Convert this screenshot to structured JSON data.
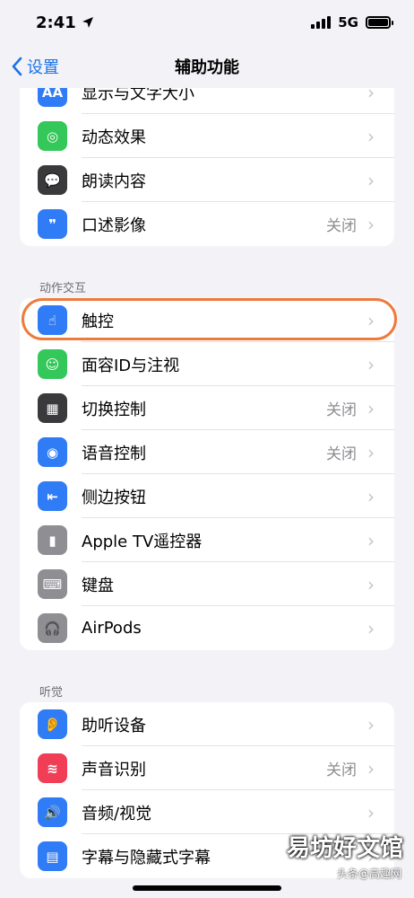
{
  "status": {
    "time": "2:41",
    "network": "5G"
  },
  "nav": {
    "back_label": "设置",
    "title": "辅助功能"
  },
  "sections": {
    "motion": "动作交互",
    "hearing": "听觉"
  },
  "vision_items": [
    {
      "label": "显示与文字大小",
      "value": "",
      "icon": "text-size-icon",
      "glyph": "AA",
      "color": "#2f7cf6"
    },
    {
      "label": "动态效果",
      "value": "",
      "icon": "motion-icon",
      "glyph": "◎",
      "color": "#34c759"
    },
    {
      "label": "朗读内容",
      "value": "",
      "icon": "speech-bubble-icon",
      "glyph": "💬",
      "color": "#3a3a3c"
    },
    {
      "label": "口述影像",
      "value": "关闭",
      "icon": "audio-description-icon",
      "glyph": "❞",
      "color": "#2f7cf6"
    }
  ],
  "motion_items": [
    {
      "label": "触控",
      "value": "",
      "icon": "touch-hand-icon",
      "glyph": "☝",
      "color": "#2f7cf6"
    },
    {
      "label": "面容ID与注视",
      "value": "",
      "icon": "face-id-icon",
      "glyph": "☺",
      "color": "#34c759"
    },
    {
      "label": "切换控制",
      "value": "关闭",
      "icon": "switch-control-icon",
      "glyph": "▦",
      "color": "#3a3a3c"
    },
    {
      "label": "语音控制",
      "value": "关闭",
      "icon": "voice-control-icon",
      "glyph": "◉",
      "color": "#2f7cf6"
    },
    {
      "label": "侧边按钮",
      "value": "",
      "icon": "side-button-icon",
      "glyph": "⇤",
      "color": "#2f7cf6"
    },
    {
      "label": "Apple TV遥控器",
      "value": "",
      "icon": "remote-icon",
      "glyph": "▮",
      "color": "#8e8e93"
    },
    {
      "label": "键盘",
      "value": "",
      "icon": "keyboard-icon",
      "glyph": "⌨",
      "color": "#8e8e93"
    },
    {
      "label": "AirPods",
      "value": "",
      "icon": "headphones-icon",
      "glyph": "🎧",
      "color": "#8e8e93"
    }
  ],
  "hearing_items": [
    {
      "label": "助听设备",
      "value": "",
      "icon": "ear-icon",
      "glyph": "👂",
      "color": "#2f7cf6"
    },
    {
      "label": "声音识别",
      "value": "关闭",
      "icon": "sound-recognition-icon",
      "glyph": "≋",
      "color": "#ef3e55"
    },
    {
      "label": "音频/视觉",
      "value": "",
      "icon": "speaker-eye-icon",
      "glyph": "🔊",
      "color": "#2f7cf6"
    },
    {
      "label": "字幕与隐藏式字幕",
      "value": "",
      "icon": "captions-icon",
      "glyph": "▤",
      "color": "#2f7cf6"
    }
  ],
  "watermark": {
    "main": "易坊好文馆",
    "sub": "头条@高趣网"
  }
}
